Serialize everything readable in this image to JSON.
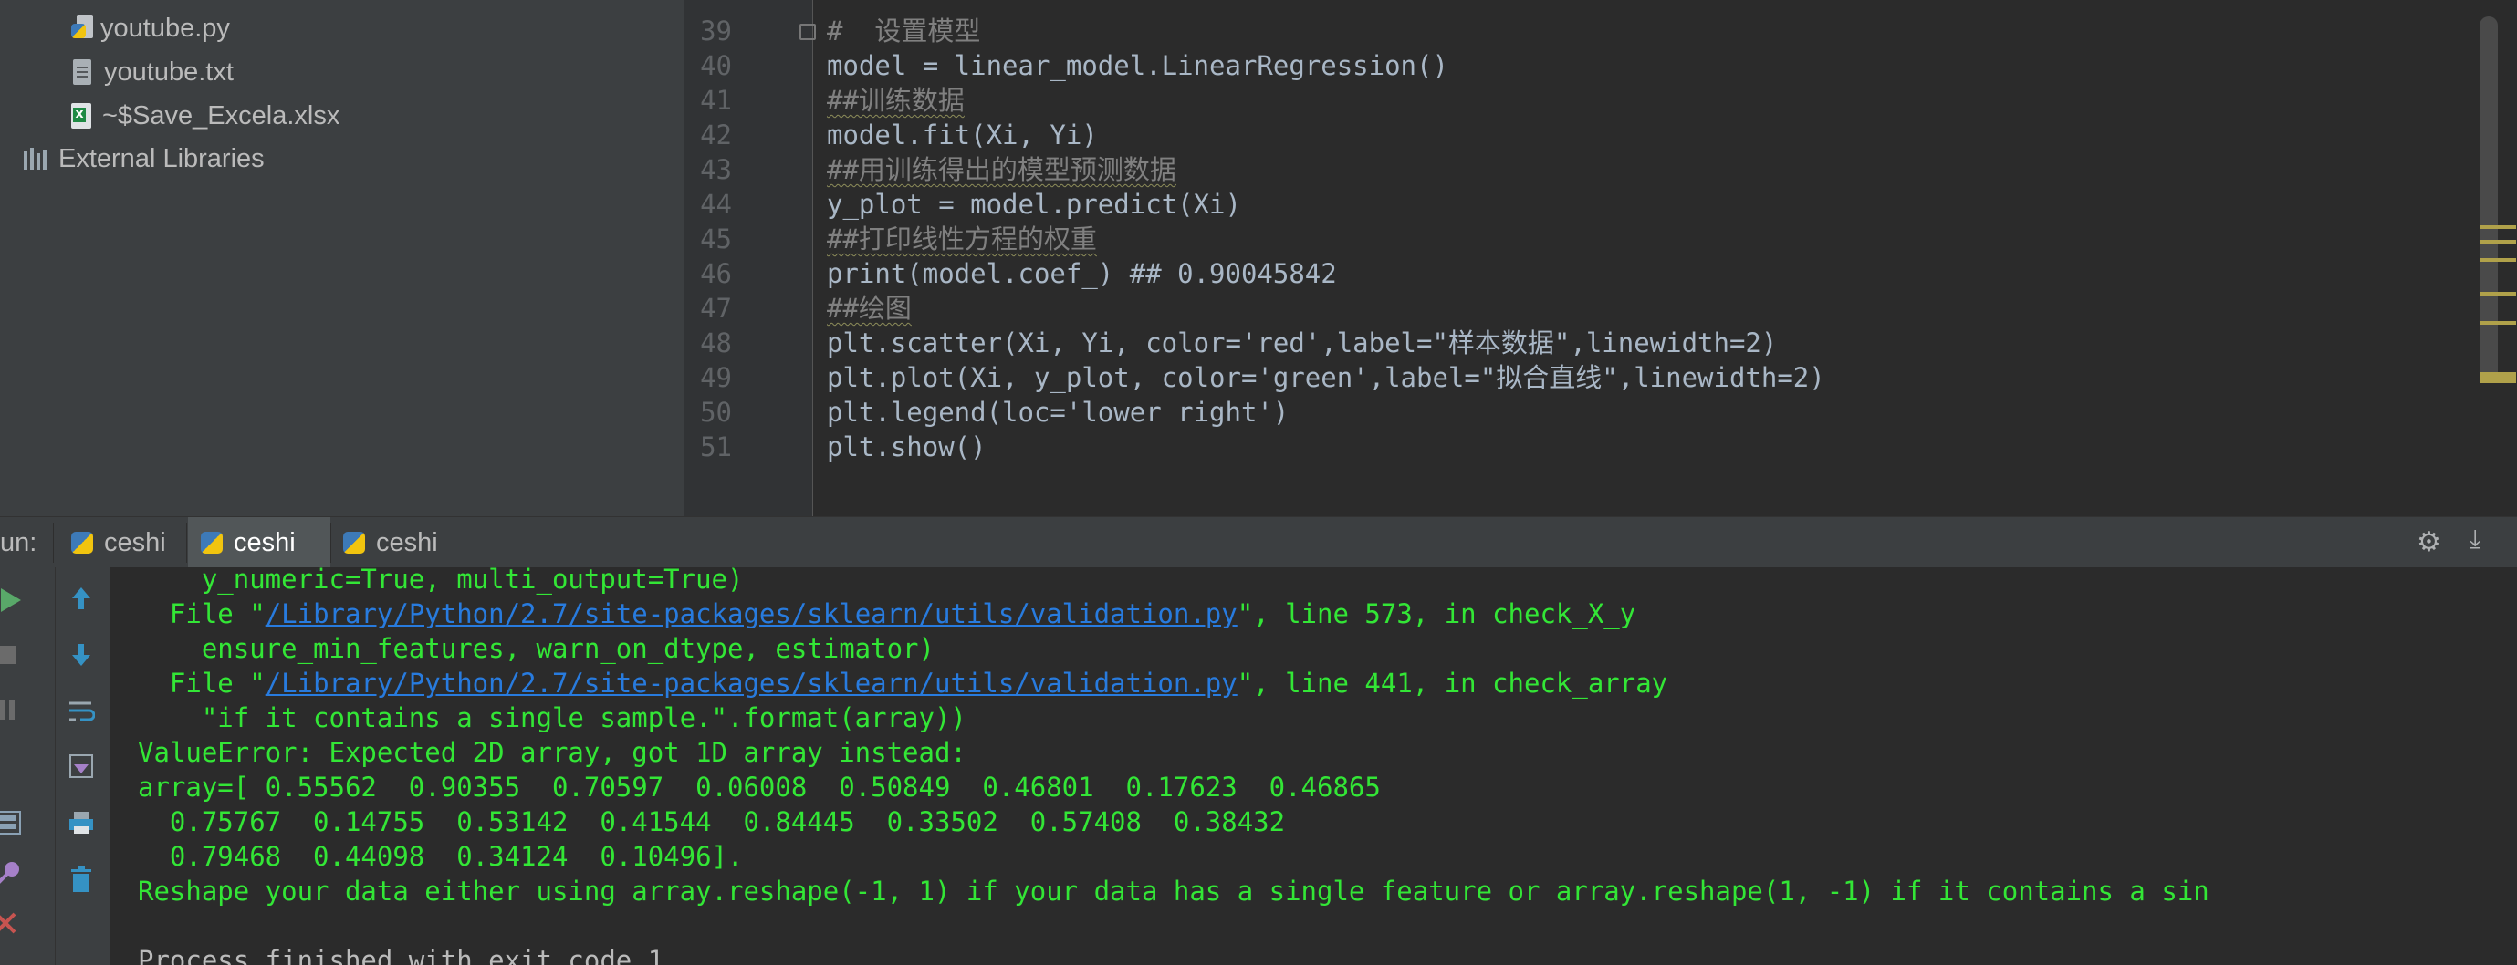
{
  "project_tree": [
    {
      "name": "youtube.py",
      "icon": "python-file-icon"
    },
    {
      "name": "youtube.txt",
      "icon": "text-file-icon"
    },
    {
      "name": "~$Save_Excela.xlsx",
      "icon": "excel-file-icon"
    },
    {
      "name": "External Libraries",
      "icon": "libraries-icon"
    }
  ],
  "editor": {
    "line_numbers": [
      "39",
      "40",
      "41",
      "42",
      "43",
      "44",
      "45",
      "46",
      "47",
      "48",
      "49",
      "50",
      "51"
    ],
    "lines": [
      "#  设置模型",
      "model = linear_model.LinearRegression()",
      "##训练数据",
      "model.fit(Xi, Yi)",
      "##用训练得出的模型预测数据",
      "y_plot = model.predict(Xi)",
      "##打印线性方程的权重",
      "print(model.coef_) ## 0.90045842",
      "##绘图",
      "plt.scatter(Xi, Yi, color='red',label=\"样本数据\",linewidth=2)",
      "plt.plot(Xi, y_plot, color='green',label=\"拟合直线\",linewidth=2)",
      "plt.legend(loc='lower right')",
      "plt.show()"
    ]
  },
  "run_panel": {
    "label": "un:",
    "tabs": [
      "ceshi",
      "ceshi",
      "ceshi"
    ],
    "active_tab_index": 1
  },
  "console": {
    "lines": [
      "    y_numeric=True, multi_output=True)",
      "  File \"/Library/Python/2.7/site-packages/sklearn/utils/validation.py\", line 573, in check_X_y",
      "    ensure_min_features, warn_on_dtype, estimator)",
      "  File \"/Library/Python/2.7/site-packages/sklearn/utils/validation.py\", line 441, in check_array",
      "    \"if it contains a single sample.\".format(array))",
      "ValueError: Expected 2D array, got 1D array instead:",
      "array=[ 0.55562  0.90355  0.70597  0.06008  0.50849  0.46801  0.17623  0.46865",
      "  0.75767  0.14755  0.53142  0.41544  0.84445  0.33502  0.57408  0.38432",
      "  0.79468  0.44098  0.34124  0.10496].",
      "Reshape your data either using array.reshape(-1, 1) if your data has a single feature or array.reshape(1, -1) if it contains a sin",
      "",
      "Process finished with exit code 1"
    ],
    "file_link": "/Library/Python/2.7/site-packages/sklearn/utils/validation.py"
  },
  "colors": {
    "console_text": "#33e636",
    "link": "#287bde",
    "keyword": "#cc7832",
    "string": "#6a8759",
    "number": "#6897bb"
  }
}
